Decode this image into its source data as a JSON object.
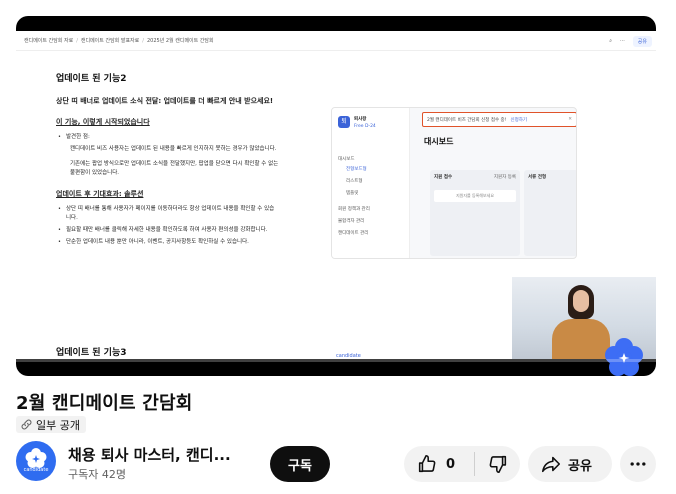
{
  "video": {
    "doc_breadcrumb": [
      "캔디메이트 간담회 자료",
      "캔디메이트 간담회 발표자료",
      "2025년 2월 캔디메이트 간담회"
    ],
    "doc_share_label": "공유",
    "doc_title_section": "업데이트 된 기능2",
    "doc_headline": "상단 띠 배너로 업데이트 소식 전달: 업데이트를 더 빠르게 안내 받으세요!",
    "doc_sub1": "이 기능, 이렇게 시작되었습니다",
    "doc_problem_label": "발견한 점:",
    "doc_problem_lines": [
      "캔디데이트 비즈 사용자는 업데이트 된 내용을 빠르게 인지하지 못하는 경우가 많았습니다.",
      "기존에는 팝업 방식으로만 업데이트 소식을 전달했지만, 팝업을 닫으면 다시 확인할 수 없는",
      "불편함이 있었습니다."
    ],
    "doc_sub2": "업데이트 후 기대효과: 솔루션",
    "doc_solution_lines": [
      "상단 띠 배너를 통해 사용자가 페이지를 이동하더라도 항상 업데이트 내용을 확인할 수 있습",
      "니다.",
      "필요할 때만 배너를 클릭해 자세한 내용을 확인하도록 하여 사용자 편의성을 강화합니다.",
      "단순한 업데이트 내용 뿐만 아니라, 이벤트, 공지사항등도 확인하실 수 있습니다."
    ],
    "doc_next_section": "업데이트 된 기능3",
    "app_org_name": "퇴사왕",
    "app_plan": "Free D-24",
    "app_nav": [
      "대시보드",
      "전형보드형",
      "리스트형",
      "템플릿",
      "회원 정책과 관리",
      "불합격자 관리",
      "캔디데이트 관리"
    ],
    "app_banner": "2월 캔디데이트 비즈 간담회 신청 접수 중!",
    "app_banner_cta": "신청하기",
    "app_dashboard_title": "대시보드",
    "app_board_col1": "지원 접수",
    "app_board_col1_action": "지원자 등록",
    "app_board_col1_empty": "지원자를 등록해보세요",
    "app_board_col2": "서류 전형",
    "app_logo_text": "candidate",
    "progress_fraction": 0.0
  },
  "title": "2월 캔디메이트 간담회",
  "visibility": "일부 공개",
  "channel": {
    "name": "채용 퇴사 마스터, 캔디...",
    "subscribers": "구독자 42명",
    "avatar_text": "candidate"
  },
  "actions": {
    "subscribe": "구독",
    "like_count": "0",
    "share": "공유"
  },
  "colors": {
    "subscribe_bg": "#0f0f0f",
    "pill_bg": "#f2f2f2",
    "brand_blue": "#2f6cf0",
    "banner_border": "#e0532a"
  }
}
